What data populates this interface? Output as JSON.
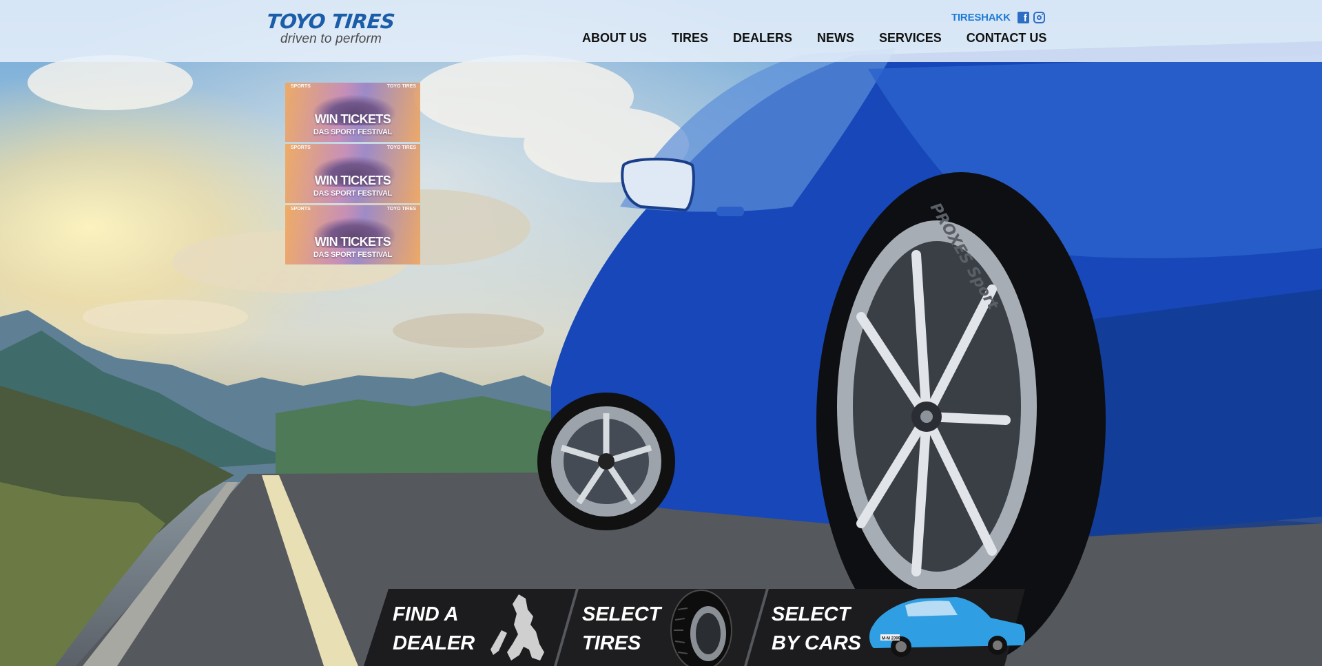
{
  "brand": {
    "name": "TOYO TIRES",
    "tagline": "driven to perform"
  },
  "header": {
    "social_link": "TIRESHAKK",
    "icons": [
      "facebook-icon",
      "instagram-icon"
    ],
    "nav": [
      {
        "label": "ABOUT US"
      },
      {
        "label": "TIRES"
      },
      {
        "label": "DEALERS"
      },
      {
        "label": "NEWS"
      },
      {
        "label": "SERVICES"
      },
      {
        "label": "CONTACT US"
      }
    ]
  },
  "promos": [
    {
      "top_left": "SPORTS",
      "top_right": "TOYO TIRES",
      "title": "WIN TICKETS",
      "subtitle": "DAS SPORT FESTIVAL"
    },
    {
      "top_left": "SPORTS",
      "top_right": "TOYO TIRES",
      "title": "WIN TICKETS",
      "subtitle": "DAS SPORT FESTIVAL"
    },
    {
      "top_left": "SPORTS",
      "top_right": "TOYO TIRES",
      "title": "WIN TICKETS",
      "subtitle": "DAS SPORT FESTIVAL"
    }
  ],
  "hero": {
    "tire_sidewall_text": "PROXES Sport",
    "plate_text": "M-M 2399"
  },
  "quick_links": [
    {
      "line1": "FIND A",
      "line2": "DEALER",
      "icon": "philippines-map-icon"
    },
    {
      "line1": "SELECT",
      "line2": "TIRES",
      "icon": "tire-icon"
    },
    {
      "line1": "SELECT",
      "line2": "BY CARS",
      "icon": "car-icon"
    }
  ],
  "colors": {
    "brand_blue": "#1b5da8",
    "link_blue": "#1e7bd6",
    "nav_text": "#111111",
    "car_blue": "#1747b8"
  }
}
